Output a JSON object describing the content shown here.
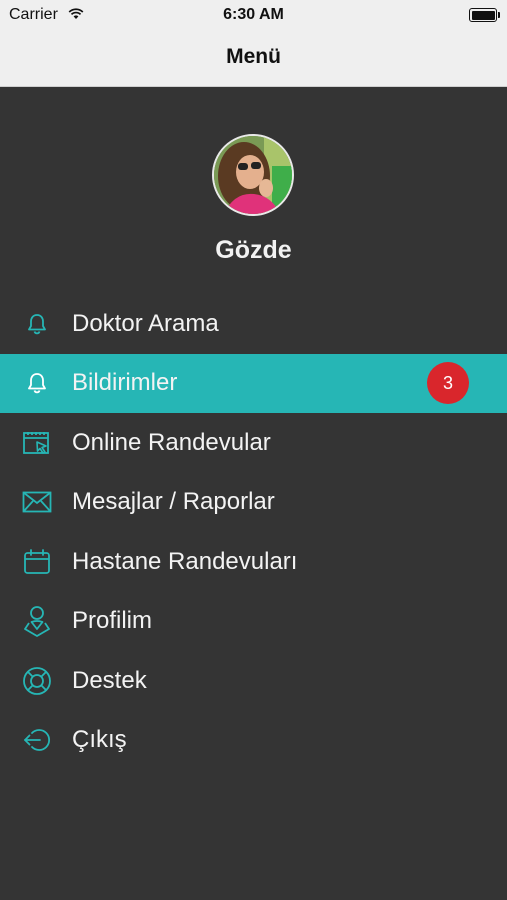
{
  "status_bar": {
    "carrier": "Carrier",
    "time": "6:30 AM"
  },
  "nav": {
    "title": "Menü"
  },
  "user": {
    "name": "Gözde"
  },
  "menu": {
    "items": [
      {
        "label": "Doktor Arama",
        "icon": "bell-icon",
        "active": false
      },
      {
        "label": "Bildirimler",
        "icon": "bell-icon",
        "active": true,
        "badge": "3"
      },
      {
        "label": "Online Randevular",
        "icon": "calendar-cursor-icon",
        "active": false
      },
      {
        "label": "Mesajlar / Raporlar",
        "icon": "envelope-icon",
        "active": false
      },
      {
        "label": "Hastane Randevuları",
        "icon": "calendar-icon",
        "active": false
      },
      {
        "label": "Profilim",
        "icon": "user-location-icon",
        "active": false
      },
      {
        "label": "Destek",
        "icon": "lifebuoy-icon",
        "active": false
      },
      {
        "label": "Çıkış",
        "icon": "logout-icon",
        "active": false
      }
    ]
  },
  "colors": {
    "accent": "#26b6b5",
    "icon": "#26b6b5",
    "background": "#343434",
    "badge": "#d9262c",
    "bar": "#efefef"
  }
}
